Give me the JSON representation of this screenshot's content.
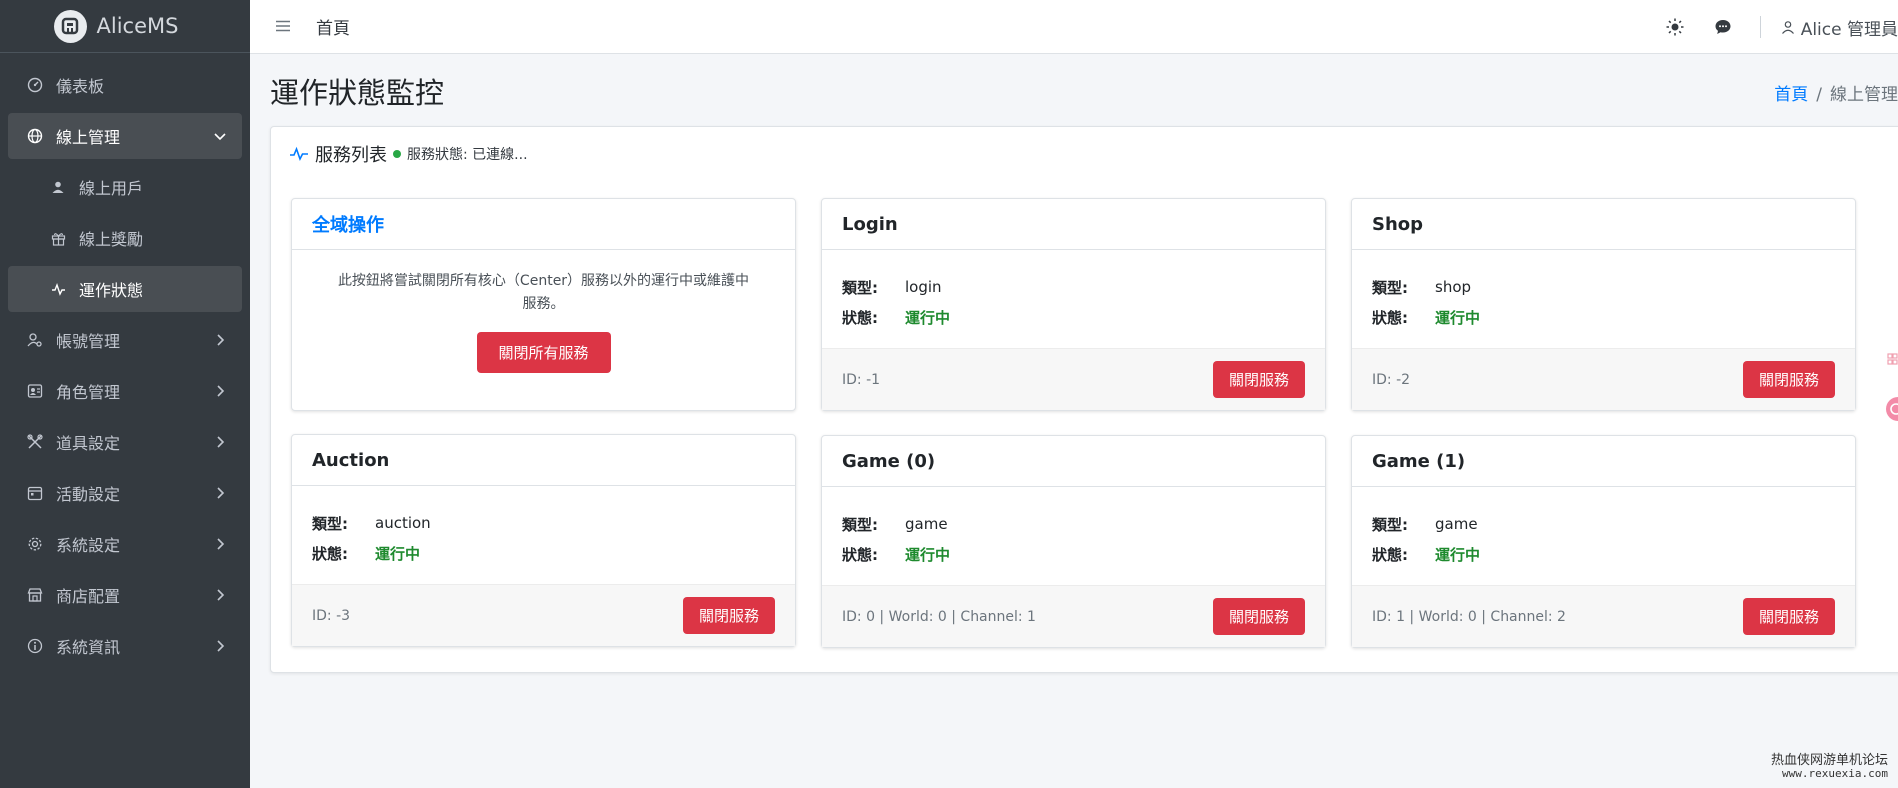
{
  "app": {
    "name": "AliceMS"
  },
  "sidebar": {
    "items": [
      {
        "label": "儀表板",
        "icon": "dashboard-icon"
      },
      {
        "label": "線上管理",
        "icon": "globe-icon"
      },
      {
        "label": "線上用戶",
        "icon": "user-icon"
      },
      {
        "label": "線上獎勵",
        "icon": "gift-icon"
      },
      {
        "label": "運作狀態",
        "icon": "pulse-icon"
      },
      {
        "label": "帳號管理",
        "icon": "user-gear-icon"
      },
      {
        "label": "角色管理",
        "icon": "users-icon"
      },
      {
        "label": "道具設定",
        "icon": "tools-icon"
      },
      {
        "label": "活動設定",
        "icon": "calendar-icon"
      },
      {
        "label": "系統設定",
        "icon": "gear-icon"
      },
      {
        "label": "商店配置",
        "icon": "shop-icon"
      },
      {
        "label": "系統資訊",
        "icon": "info-icon"
      }
    ]
  },
  "header": {
    "home": "首頁",
    "user": "Alice 管理員"
  },
  "page": {
    "title": "運作狀態監控",
    "breadcrumb": {
      "home": "首頁",
      "sep": "/",
      "current": "線上管理"
    }
  },
  "service_list": {
    "title": "服務列表",
    "status": "服務狀態: 已連線..."
  },
  "global_ops": {
    "title": "全域操作",
    "description": "此按鈕將嘗試關閉所有核心（Center）服務以外的運行中或維護中服務。",
    "button": "關閉所有服務"
  },
  "labels": {
    "type": "類型:",
    "status": "狀態:",
    "close_button": "關閉服務"
  },
  "services": [
    {
      "name": "Login",
      "type": "login",
      "status": "運行中",
      "id_info": "ID: -1"
    },
    {
      "name": "Shop",
      "type": "shop",
      "status": "運行中",
      "id_info": "ID: -2"
    },
    {
      "name": "Auction",
      "type": "auction",
      "status": "運行中",
      "id_info": "ID: -3"
    },
    {
      "name": "Game (0)",
      "type": "game",
      "status": "運行中",
      "id_info": "ID: 0 | World: 0 | Channel: 1"
    },
    {
      "name": "Game (1)",
      "type": "game",
      "status": "運行中",
      "id_info": "ID: 1 | World: 0 | Channel: 2"
    }
  ],
  "watermark": {
    "line1": "热血侠网游单机论坛",
    "line2": "www.rexuexia.com"
  },
  "colors": {
    "sidebar": "#343a40",
    "primary": "#007bff",
    "danger": "#dc3545",
    "success": "#1e8a2e"
  }
}
